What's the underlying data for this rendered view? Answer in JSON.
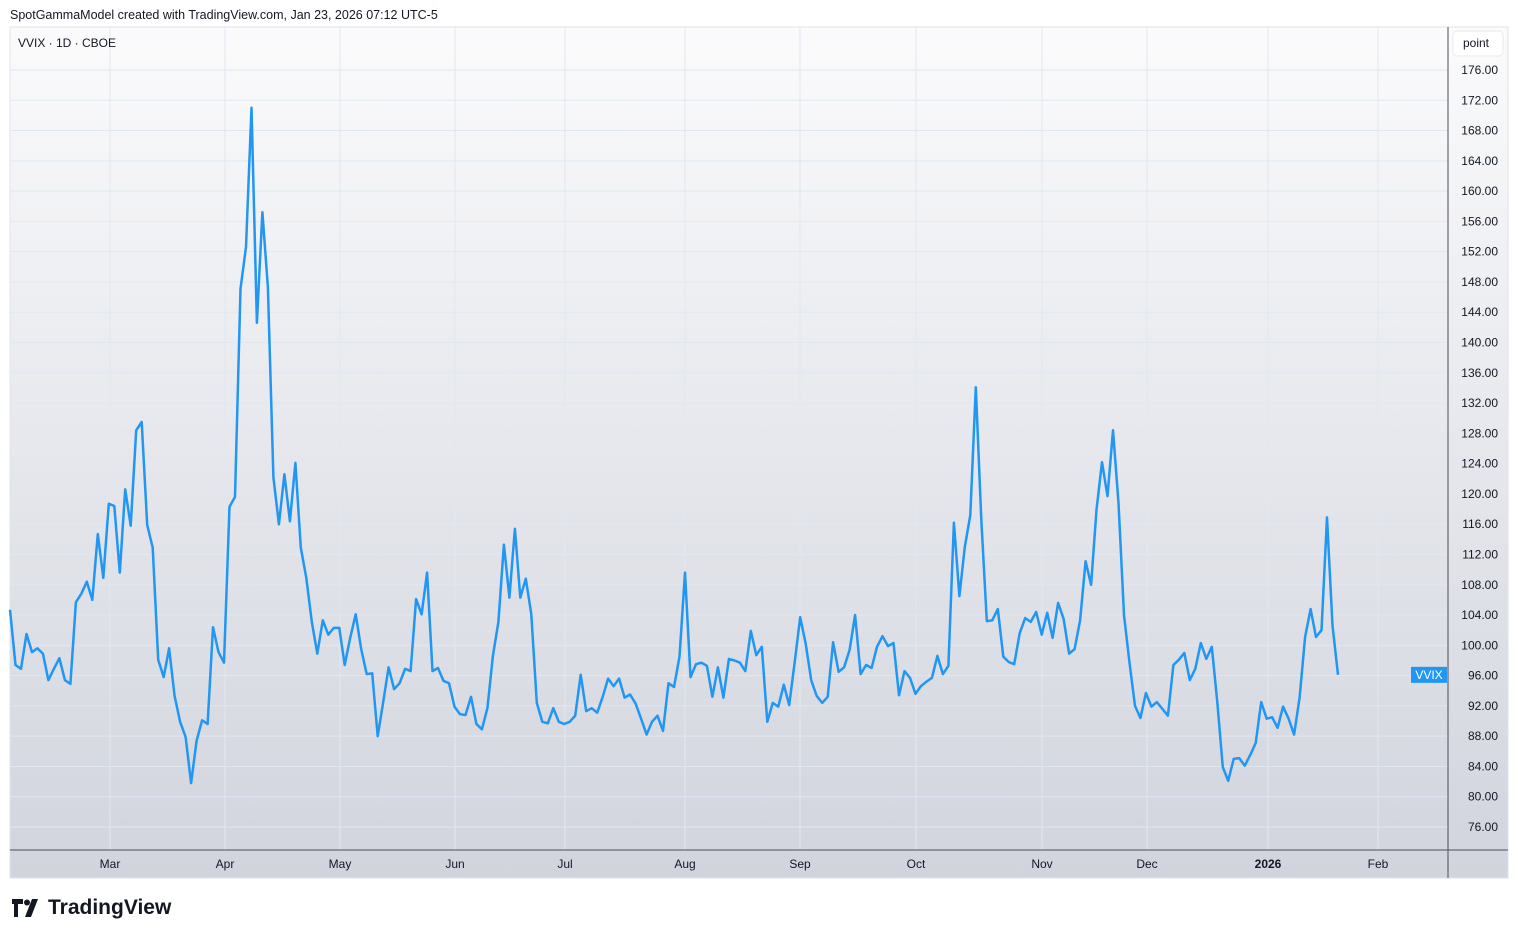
{
  "header": {
    "attribution": "SpotGammaModel created with TradingView.com, Jan 23, 2026 07:12 UTC-5"
  },
  "branding": {
    "logo_text": "TradingView"
  },
  "colors": {
    "line": "#2196f3",
    "grid": "#e0e8f2",
    "axis": "#4a4e5a",
    "label_bg": "#2196f3"
  },
  "chart_data": {
    "type": "line",
    "title": "VVIX · 1D · CBOE",
    "symbol_label": "VVIX",
    "unit_label": "point",
    "xlabel": "",
    "ylabel": "",
    "ylim": [
      72,
      178
    ],
    "y_ticks": [
      "176.00",
      "172.00",
      "168.00",
      "164.00",
      "160.00",
      "156.00",
      "152.00",
      "148.00",
      "144.00",
      "140.00",
      "136.00",
      "132.00",
      "128.00",
      "124.00",
      "120.00",
      "116.00",
      "112.00",
      "108.00",
      "104.00",
      "100.00",
      "96.00",
      "92.00",
      "88.00",
      "84.00",
      "80.00",
      "76.00"
    ],
    "x_ticks": [
      "Mar",
      "Apr",
      "May",
      "Jun",
      "Jul",
      "Aug",
      "Sep",
      "Oct",
      "Nov",
      "Dec",
      "2026",
      "Feb"
    ],
    "last_value": 96.1,
    "series": [
      {
        "name": "VVIX",
        "values": [
          104.7,
          97.4,
          96.9,
          101.5,
          99.1,
          99.6,
          98.9,
          95.4,
          96.9,
          98.3,
          95.4,
          94.9,
          105.7,
          106.8,
          108.4,
          106,
          114.7,
          108.9,
          118.7,
          118.4,
          109.6,
          120.6,
          115.8,
          128.4,
          129.5,
          115.9,
          112.9,
          98.1,
          95.8,
          99.6,
          93.3,
          89.9,
          87.9,
          81.8,
          87.4,
          90.1,
          89.6,
          102.4,
          99.1,
          97.7,
          118.3,
          119.6,
          147.1,
          152.6,
          171,
          142.6,
          157.2,
          147.3,
          122.2,
          116,
          122.6,
          116.4,
          124.1,
          112.9,
          108.9,
          103.1,
          98.9,
          103.3,
          101.4,
          102.3,
          102.3,
          97.4,
          101,
          104.1,
          99.5,
          96.2,
          96.3,
          88,
          92.5,
          97.1,
          94.2,
          95,
          96.9,
          96.6,
          106.1,
          104.1,
          109.6,
          96.6,
          97,
          95.3,
          95,
          91.9,
          90.9,
          90.8,
          93.2,
          89.6,
          88.9,
          91.7,
          98.6,
          103.1,
          113.3,
          106.3,
          115.4,
          106.3,
          108.8,
          104.1,
          92.4,
          89.9,
          89.7,
          91.7,
          89.9,
          89.6,
          89.9,
          90.7,
          96.1,
          91.3,
          91.7,
          91.1,
          93.2,
          95.6,
          94.6,
          95.6,
          93.1,
          93.5,
          92.3,
          90.3,
          88.2,
          89.9,
          90.7,
          88.7,
          95,
          94.5,
          98.5,
          109.6,
          95.8,
          97.5,
          97.7,
          97.3,
          93.2,
          97.1,
          93.1,
          98.2,
          98,
          97.7,
          96.6,
          101.9,
          98.7,
          99.8,
          89.9,
          92.4,
          91.9,
          94.8,
          92.1,
          97.8,
          103.7,
          100.2,
          95.4,
          93.3,
          92.4,
          93.2,
          100.4,
          96.5,
          97.1,
          99.4,
          104,
          96.2,
          97.4,
          97,
          99.8,
          101.2,
          99.9,
          100.3,
          93.4,
          96.6,
          95.7,
          93.6,
          94.6,
          95.2,
          95.7,
          98.6,
          96.2,
          97.3,
          116.2,
          106.5,
          113,
          117.2,
          134.1,
          116.6,
          103.2,
          103.3,
          104.8,
          98.5,
          97.8,
          97.5,
          101.6,
          103.6,
          103.1,
          104.4,
          101.4,
          104.3,
          101,
          105.6,
          103.5,
          98.9,
          99.5,
          103.3,
          111.1,
          108,
          117.9,
          124.2,
          119.7,
          128.4,
          118.8,
          104,
          97.7,
          92,
          90.4,
          93.7,
          91.9,
          92.5,
          91.6,
          90.7,
          97.4,
          98.1,
          99,
          95.4,
          96.9,
          100.3,
          98.2,
          99.8,
          92.5,
          83.9,
          82.1,
          85,
          85.1,
          84.1,
          85.5,
          87.1,
          92.5,
          90.3,
          90.5,
          89.1,
          91.9,
          90.3,
          88.2,
          93.1,
          101.1,
          104.8,
          101.1,
          102,
          116.9,
          102.6,
          96.1
        ]
      }
    ]
  }
}
